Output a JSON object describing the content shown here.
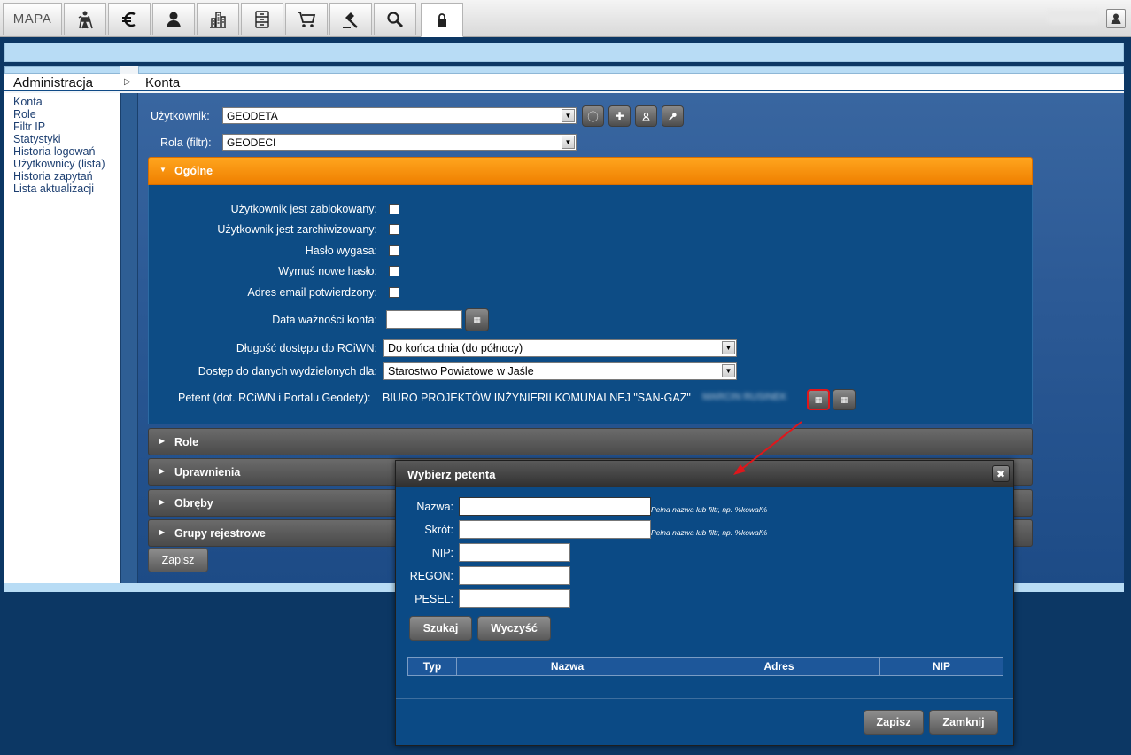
{
  "toolbar": {
    "mapa_label": "MAPA",
    "buttons": [
      "surveyor-icon",
      "euro-icon",
      "person-icon",
      "buildings-icon",
      "cabinet-icon",
      "cart-icon",
      "gavel-icon",
      "search-icon",
      "lock-icon"
    ]
  },
  "headers": {
    "left": "Administracja",
    "right": "Konta"
  },
  "sidebar": {
    "items": [
      {
        "label": "Konta"
      },
      {
        "label": "Role"
      },
      {
        "label": "Filtr IP"
      },
      {
        "label": "Statystyki"
      },
      {
        "label": "Historia logowań"
      },
      {
        "label": "Użytkownicy (lista)"
      },
      {
        "label": "Historia zapytań"
      },
      {
        "label": "Lista aktualizacji"
      }
    ]
  },
  "form": {
    "user_label": "Użytkownik:",
    "user_value": "GEODETA",
    "role_label": "Rola (filtr):",
    "role_value": "GEODECI"
  },
  "ogolne": {
    "title": "Ogólne",
    "blocked_label": "Użytkownik jest zablokowany:",
    "archived_label": "Użytkownik jest zarchiwizowany:",
    "pw_expires_label": "Hasło wygasa:",
    "force_pw_label": "Wymuś nowe hasło:",
    "email_confirmed_label": "Adres email potwierdzony:",
    "validity_label": "Data ważności konta:",
    "access_length_label": "Długość dostępu do RCiWN:",
    "access_length_value": "Do końca dnia (do północy)",
    "access_data_label": "Dostęp do danych wydzielonych dla:",
    "access_data_value": "Starostwo Powiatowe w Jaśle",
    "petent_label": "Petent (dot. RCiWN i Portalu Geodety):",
    "petent_value": "BIURO PROJEKTÓW INŻYNIERII KOMUNALNEJ \"SAN-GAZ\"",
    "petent_blurred": "MARCIN RUSINEK"
  },
  "sections": [
    {
      "title": "Role"
    },
    {
      "title": "Uprawnienia"
    },
    {
      "title": "Obręby"
    },
    {
      "title": "Grupy rejestrowe"
    }
  ],
  "save_label": "Zapisz",
  "dialog": {
    "title": "Wybierz petenta",
    "nazwa_label": "Nazwa:",
    "skrot_label": "Skrót:",
    "nip_label": "NIP:",
    "regon_label": "REGON:",
    "pesel_label": "PESEL:",
    "hint": "Pełna nazwa lub filtr, np. %kowal%",
    "search_button": "Szukaj",
    "clear_button": "Wyczyść",
    "columns": [
      "Typ",
      "Nazwa",
      "Adres",
      "NIP"
    ],
    "save_button": "Zapisz",
    "close_button": "Zamknij"
  },
  "colors": {
    "accent_orange": "#f28a00",
    "panel_blue": "#0d4c85",
    "highlight_red": "#e0161b"
  }
}
